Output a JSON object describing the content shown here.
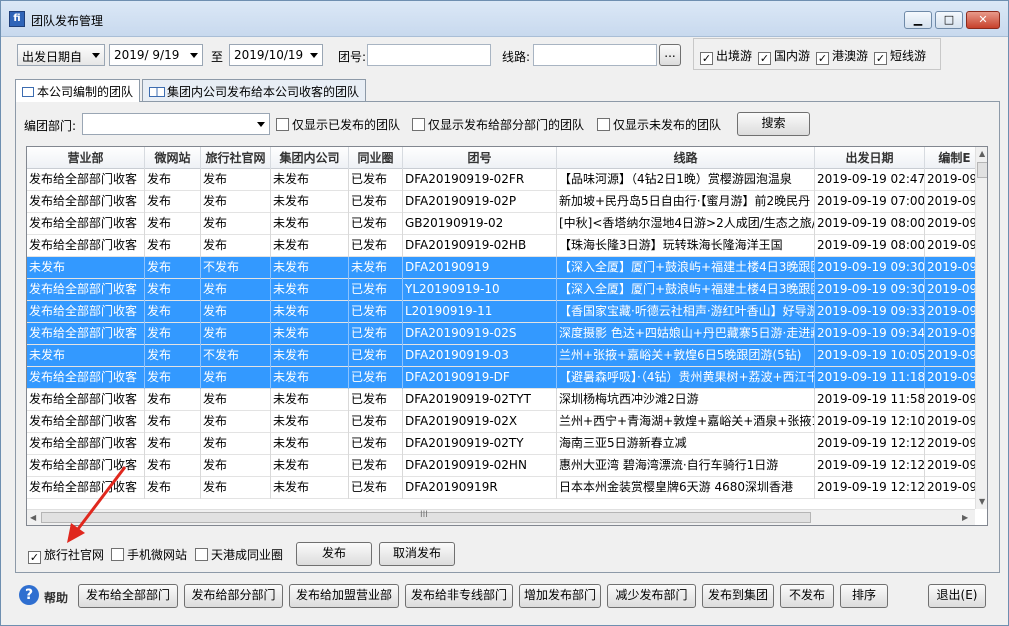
{
  "window": {
    "title": "团队发布管理",
    "app_icon_letter": "fi"
  },
  "filters": {
    "date_type": "出发日期自",
    "date_from": "2019/ 9/19",
    "date_to_label": "至",
    "date_to": "2019/10/19",
    "group_no_label": "团号:",
    "group_no_value": "",
    "route_label": "线路:",
    "route_value": "",
    "route_browse": "...",
    "types": [
      {
        "label": "出境游",
        "checked": true
      },
      {
        "label": "国内游",
        "checked": true
      },
      {
        "label": "港澳游",
        "checked": true
      },
      {
        "label": "短线游",
        "checked": true
      }
    ]
  },
  "tabs": [
    {
      "label": "本公司编制的团队",
      "active": true
    },
    {
      "label": "集团内公司发布给本公司收客的团队",
      "active": false
    }
  ],
  "search_row": {
    "dept_label": "编团部门:",
    "dept_value": "",
    "options": [
      {
        "label": "仅显示已发布的团队",
        "checked": false
      },
      {
        "label": "仅显示发布给部分部门的团队",
        "checked": false
      },
      {
        "label": "仅显示未发布的团队",
        "checked": false
      }
    ],
    "search_button": "搜索"
  },
  "table": {
    "columns": [
      "营业部",
      "微网站",
      "旅行社官网",
      "集团内公司",
      "同业圈",
      "团号",
      "线路",
      "出发日期",
      "编制E"
    ],
    "rows": [
      {
        "selected": false,
        "cells": [
          "发布给全部部门收客",
          "发布",
          "发布",
          "未发布",
          "已发布",
          "DFA20190919-02FR",
          "【品味河源】（4钻2日1晚）赏樱游园泡温泉",
          "2019-09-19 02:47",
          "2019-09"
        ]
      },
      {
        "selected": false,
        "cells": [
          "发布给全部部门收客",
          "发布",
          "发布",
          "未发布",
          "已发布",
          "DFA20190919-02P",
          "新加坡+民丹岛5日自由行·【蜜月游】前2晚民丹",
          "2019-09-19 07:00",
          "2019-09"
        ]
      },
      {
        "selected": false,
        "cells": [
          "发布给全部部门收客",
          "发布",
          "发布",
          "未发布",
          "已发布",
          "GB20190919-02",
          "[中秋]<香塔纳尔湿地4日游>2人成团/生态之旅/摄",
          "2019-09-19 08:00",
          "2019-09"
        ]
      },
      {
        "selected": false,
        "cells": [
          "发布给全部部门收客",
          "发布",
          "发布",
          "未发布",
          "已发布",
          "DFA20190919-02HB",
          "【珠海长隆3日游】玩转珠海长隆海洋王国",
          "2019-09-19 08:00",
          "2019-09"
        ]
      },
      {
        "selected": true,
        "cells": [
          "未发布",
          "发布",
          "不发布",
          "未发布",
          "未发布",
          "DFA20190919",
          "【深入全厦】厦门+鼓浪屿+福建土楼4日3晚跟团",
          "2019-09-19 09:30",
          "2019-09"
        ]
      },
      {
        "selected": true,
        "cells": [
          "发布给全部部门收客",
          "发布",
          "发布",
          "未发布",
          "已发布",
          "YL20190919-10",
          "【深入全厦】厦门+鼓浪屿+福建土楼4日3晚跟团",
          "2019-09-19 09:30",
          "2019-09"
        ]
      },
      {
        "selected": true,
        "cells": [
          "发布给全部部门收客",
          "发布",
          "发布",
          "未发布",
          "已发布",
          "L20190919-11",
          "【香国家宝藏·听德云社相声·游红叶香山】好导游",
          "2019-09-19 09:33",
          "2019-09"
        ]
      },
      {
        "selected": true,
        "cells": [
          "发布给全部部门收客",
          "发布",
          "发布",
          "未发布",
          "已发布",
          "DFA20190919-02S",
          "深度摄影 色达+四姑娘山+丹巴藏寨5日游·走进藏",
          "2019-09-19 09:34",
          "2019-09"
        ]
      },
      {
        "selected": true,
        "cells": [
          "未发布",
          "发布",
          "不发布",
          "未发布",
          "已发布",
          "DFA20190919-03",
          "兰州+张掖+嘉峪关+敦煌6日5晚跟团游(5钻)",
          "2019-09-19 10:05",
          "2019-09"
        ]
      },
      {
        "selected": true,
        "cells": [
          "发布给全部部门收客",
          "发布",
          "发布",
          "未发布",
          "已发布",
          "DFA20190919-DF",
          "【避暑森呼吸】·（4钻）贵州黄果树+荔波+西江千",
          "2019-09-19 11:18",
          "2019-09"
        ]
      },
      {
        "selected": false,
        "cells": [
          "发布给全部部门收客",
          "发布",
          "发布",
          "未发布",
          "已发布",
          "DFA20190919-02TYT",
          "深圳杨梅坑西冲沙滩2日游",
          "2019-09-19 11:58",
          "2019-09"
        ]
      },
      {
        "selected": false,
        "cells": [
          "发布给全部部门收客",
          "发布",
          "发布",
          "未发布",
          "已发布",
          "DFA20190919-02X",
          "兰州+西宁+青海湖+敦煌+嘉峪关+酒泉+张掖10E",
          "2019-09-19 12:10",
          "2019-09"
        ]
      },
      {
        "selected": false,
        "cells": [
          "发布给全部部门收客",
          "发布",
          "发布",
          "未发布",
          "已发布",
          "DFA20190919-02TY",
          "海南三亚5日游新春立减",
          "2019-09-19 12:12",
          "2019-09"
        ]
      },
      {
        "selected": false,
        "cells": [
          "发布给全部部门收客",
          "发布",
          "发布",
          "未发布",
          "已发布",
          "DFA20190919-02HN",
          "惠州大亚湾 碧海湾漂流·自行车骑行1日游",
          "2019-09-19 12:12",
          "2019-09"
        ]
      },
      {
        "selected": false,
        "cells": [
          "发布给全部部门收客",
          "发布",
          "发布",
          "未发布",
          "已发布",
          "DFA20190919R",
          "日本本州金装赏樱皇牌6天游  4680深圳香港",
          "2019-09-19 12:12",
          "2019-09"
        ]
      }
    ],
    "hscroll_grip": "III"
  },
  "publish_row": {
    "options": [
      {
        "label": "旅行社官网",
        "checked": true
      },
      {
        "label": "手机微网站",
        "checked": false
      },
      {
        "label": "天港成同业圈",
        "checked": false
      }
    ],
    "publish_button": "发布",
    "unpublish_button": "取消发布"
  },
  "footer": {
    "help_label": "帮助",
    "help_icon_glyph": "?",
    "buttons": [
      "发布给全部部门",
      "发布给部分部门",
      "发布给加盟营业部",
      "发布给非专线部门",
      "增加发布部门",
      "减少发布部门",
      "发布到集团",
      "不发布",
      "排序"
    ],
    "exit_button": "退出(E)"
  },
  "colors": {
    "selection": "#3399ff",
    "annotation_arrow": "#e0281e"
  }
}
